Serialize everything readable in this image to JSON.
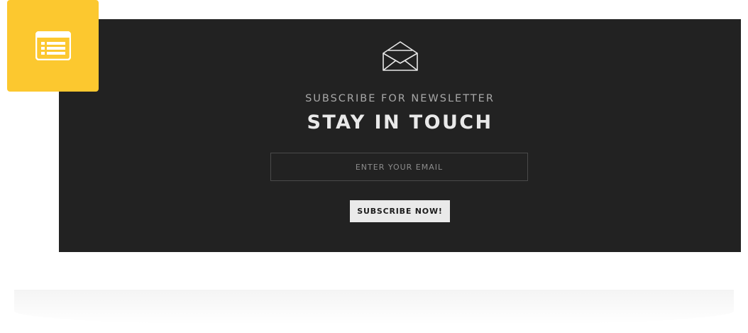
{
  "badge": {
    "icon": "list-icon",
    "color": "#fcc82f"
  },
  "newsletter": {
    "icon": "envelope-open-icon",
    "eyebrow": "SUBSCRIBE FOR NEWSLETTER",
    "headline": "STAY IN TOUCH",
    "email_placeholder": "ENTER YOUR EMAIL",
    "email_value": "",
    "button_label": "SUBSCRIBE NOW!",
    "panel_color": "#222222",
    "button_color": "#eaeaea"
  }
}
